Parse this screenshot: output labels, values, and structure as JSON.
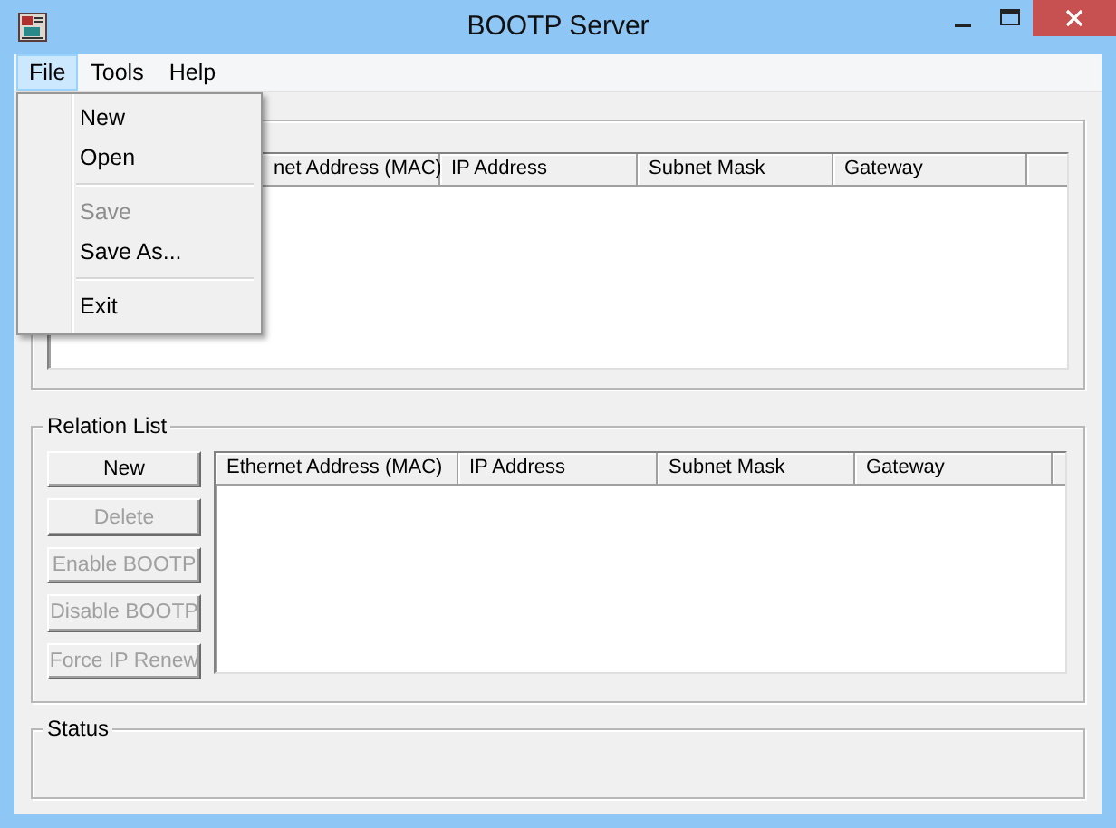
{
  "window": {
    "title": "BOOTP Server"
  },
  "menu_bar": [
    {
      "label": "File",
      "selected": true
    },
    {
      "label": "Tools",
      "selected": false
    },
    {
      "label": "Help",
      "selected": false
    }
  ],
  "file_menu": [
    {
      "kind": "item",
      "label": "New",
      "disabled": false
    },
    {
      "kind": "item",
      "label": "Open",
      "disabled": false
    },
    {
      "kind": "separator"
    },
    {
      "kind": "item",
      "label": "Save",
      "disabled": true
    },
    {
      "kind": "item",
      "label": "Save As...",
      "disabled": false
    },
    {
      "kind": "separator"
    },
    {
      "kind": "item",
      "label": "Exit",
      "disabled": false
    }
  ],
  "top_list": {
    "columns": [
      "net Address (MAC)",
      "IP Address",
      "Subnet Mask",
      "Gateway"
    ]
  },
  "relation_list": {
    "title": "Relation List",
    "buttons": [
      {
        "label": "New",
        "disabled": false
      },
      {
        "label": "Delete",
        "disabled": true
      },
      {
        "label": "Enable BOOTP",
        "disabled": true
      },
      {
        "label": "Disable BOOTP",
        "disabled": true
      },
      {
        "label": "Force IP Renew",
        "disabled": true
      }
    ],
    "columns": [
      "Ethernet Address (MAC)",
      "IP Address",
      "Subnet Mask",
      "Gateway"
    ]
  },
  "status": {
    "title": "Status"
  }
}
